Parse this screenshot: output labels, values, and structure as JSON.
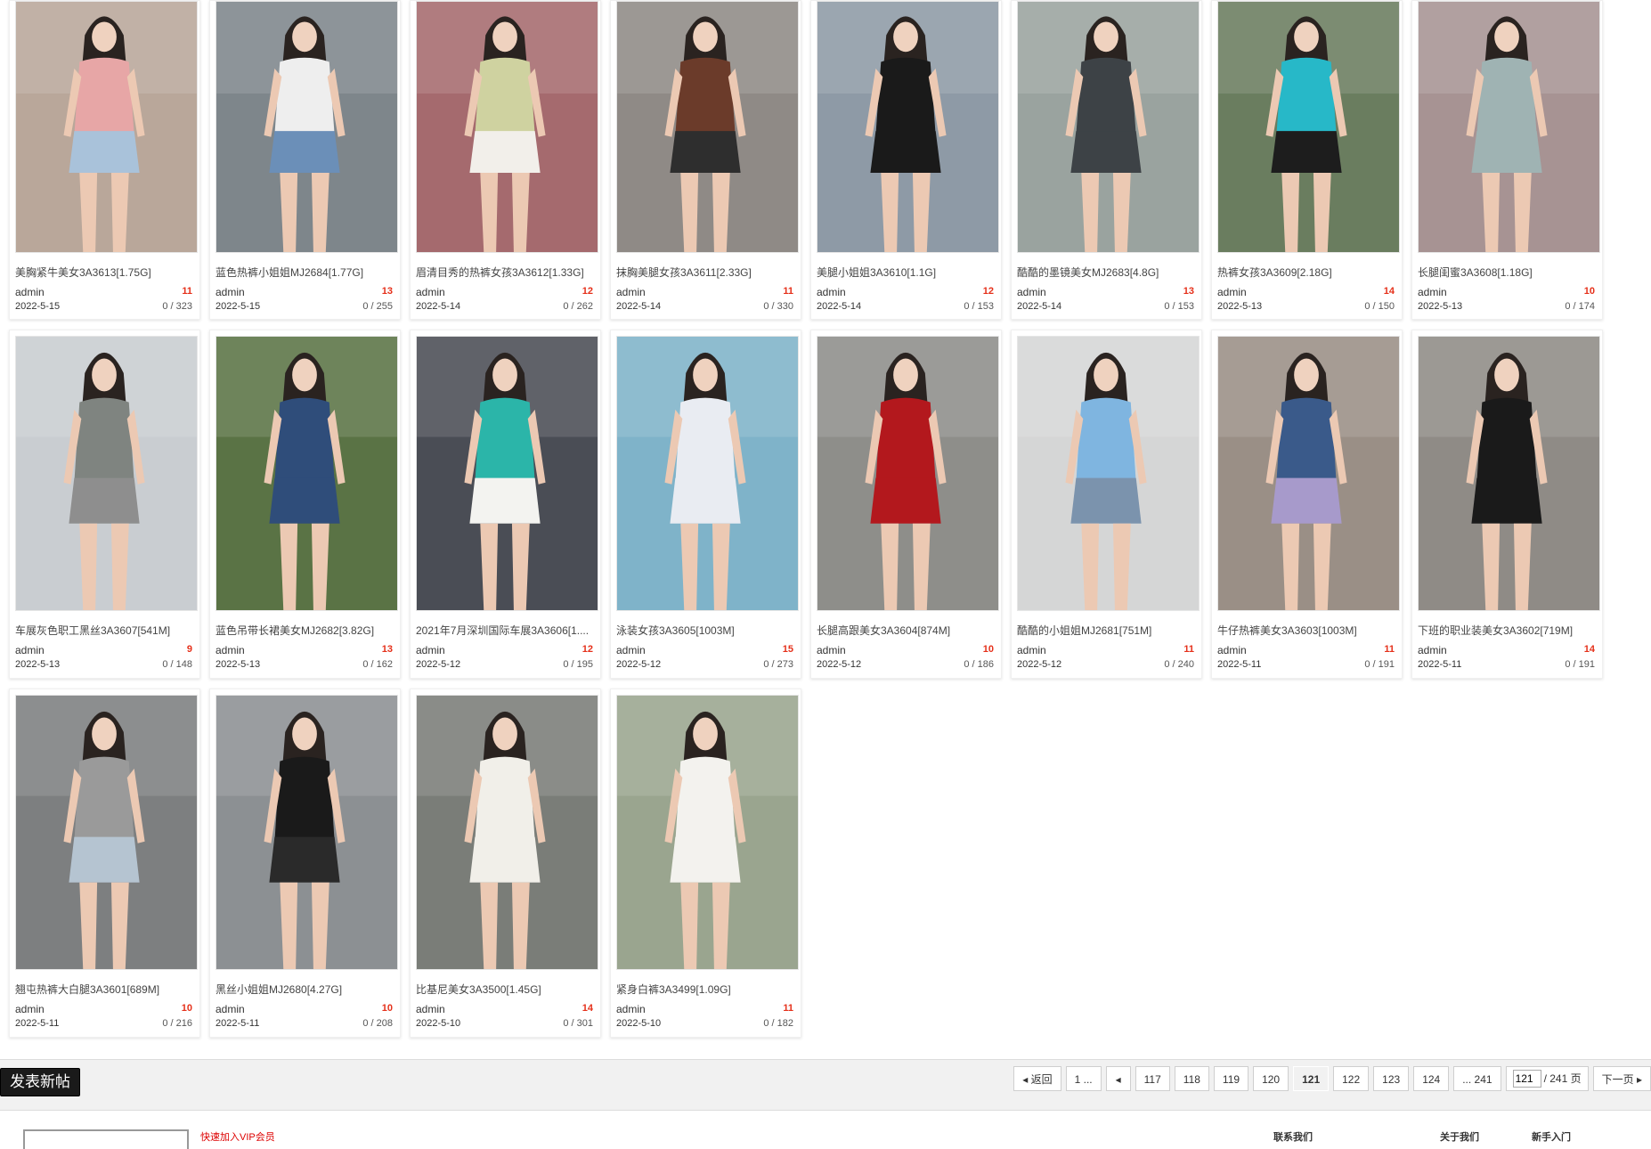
{
  "posts": [
    {
      "title": "美胸紧牛美女3A3613[1.75G]",
      "author": "admin",
      "date": "2022-5-15",
      "count": "11",
      "replies": "0 / 323",
      "bg": "#b9a79a",
      "fig": "#e7a6a6",
      "fig2": "#a9c2da"
    },
    {
      "title": "蓝色热裤小姐姐MJ2684[1.77G]",
      "author": "admin",
      "date": "2022-5-15",
      "count": "13",
      "replies": "0 / 255",
      "bg": "#7e868b",
      "fig": "#eeeeee",
      "fig2": "#6b8fb8"
    },
    {
      "title": "眉清目秀的热裤女孩3A3612[1.33G]",
      "author": "admin",
      "date": "2022-5-14",
      "count": "12",
      "replies": "0 / 262",
      "bg": "#a56a6e",
      "fig": "#cfd2a0",
      "fig2": "#f2efea"
    },
    {
      "title": "抹胸美腿女孩3A3611[2.33G]",
      "author": "admin",
      "date": "2022-5-14",
      "count": "11",
      "replies": "0 / 330",
      "bg": "#8f8a86",
      "fig": "#6b3b2a",
      "fig2": "#2e2e2e"
    },
    {
      "title": "美腿小姐姐3A3610[1.1G]",
      "author": "admin",
      "date": "2022-5-14",
      "count": "12",
      "replies": "0 / 153",
      "bg": "#8e9aa6",
      "fig": "#1a1a1a",
      "fig2": "#1a1a1a"
    },
    {
      "title": "酷酷的墨镜美女MJ2683[4.8G]",
      "author": "admin",
      "date": "2022-5-14",
      "count": "13",
      "replies": "0 / 153",
      "bg": "#9aa39f",
      "fig": "#3d4246",
      "fig2": "#3d4246"
    },
    {
      "title": "热裤女孩3A3609[2.18G]",
      "author": "admin",
      "date": "2022-5-13",
      "count": "14",
      "replies": "0 / 150",
      "bg": "#6a7d5f",
      "fig": "#27b8c8",
      "fig2": "#1d1d1d"
    },
    {
      "title": "长腿闺蜜3A3608[1.18G]",
      "author": "admin",
      "date": "2022-5-13",
      "count": "10",
      "replies": "0 / 174",
      "bg": "#a79393",
      "fig": "#9fb3b3",
      "fig2": "#9fb3b3"
    },
    {
      "title": "车展灰色职工黑丝3A3607[541M]",
      "author": "admin",
      "date": "2022-5-13",
      "count": "9",
      "replies": "0 / 148",
      "bg": "#c9cdd1",
      "fig": "#7f8480",
      "fig2": "#8e8e8e"
    },
    {
      "title": "蓝色吊带长裙美女MJ2682[3.82G]",
      "author": "admin",
      "date": "2022-5-13",
      "count": "13",
      "replies": "0 / 162",
      "bg": "#5a7345",
      "fig": "#2f4d7a",
      "fig2": "#2f4d7a"
    },
    {
      "title": "2021年7月深圳国际车展3A3606[1....",
      "author": "admin",
      "date": "2022-5-12",
      "count": "12",
      "replies": "0 / 195",
      "bg": "#4a4d55",
      "fig": "#2bb5a9",
      "fig2": "#f3f3f0"
    },
    {
      "title": "泳装女孩3A3605[1003M]",
      "author": "admin",
      "date": "2022-5-12",
      "count": "15",
      "replies": "0 / 273",
      "bg": "#7fb3c9",
      "fig": "#e9ecf2",
      "fig2": "#e9ecf2"
    },
    {
      "title": "长腿高跟美女3A3604[874M]",
      "author": "admin",
      "date": "2022-5-12",
      "count": "10",
      "replies": "0 / 186",
      "bg": "#8e8e8a",
      "fig": "#b3181d",
      "fig2": "#b3181d"
    },
    {
      "title": "酷酷的小姐姐MJ2681[751M]",
      "author": "admin",
      "date": "2022-5-12",
      "count": "11",
      "replies": "0 / 240",
      "bg": "#d5d6d6",
      "fig": "#7fb5e0",
      "fig2": "#7b93ad"
    },
    {
      "title": "牛仔热裤美女3A3603[1003M]",
      "author": "admin",
      "date": "2022-5-11",
      "count": "11",
      "replies": "0 / 191",
      "bg": "#9a8f86",
      "fig": "#3a5a8a",
      "fig2": "#a79acb"
    },
    {
      "title": "下班的职业装美女3A3602[719M]",
      "author": "admin",
      "date": "2022-5-11",
      "count": "14",
      "replies": "0 / 191",
      "bg": "#8f8b86",
      "fig": "#1a1a1a",
      "fig2": "#1a1a1a"
    },
    {
      "title": "翘屯热裤大白腿3A3601[689M]",
      "author": "admin",
      "date": "2022-5-11",
      "count": "10",
      "replies": "0 / 216",
      "bg": "#7d7f80",
      "fig": "#9a9a9a",
      "fig2": "#b5c4d1"
    },
    {
      "title": "黑丝小姐姐MJ2680[4.27G]",
      "author": "admin",
      "date": "2022-5-11",
      "count": "10",
      "replies": "0 / 208",
      "bg": "#8c9093",
      "fig": "#1a1a1a",
      "fig2": "#2a2a2a"
    },
    {
      "title": "比基尼美女3A3500[1.45G]",
      "author": "admin",
      "date": "2022-5-10",
      "count": "14",
      "replies": "0 / 301",
      "bg": "#7a7d78",
      "fig": "#f1efe9",
      "fig2": "#f1efe9"
    },
    {
      "title": "紧身白裤3A3499[1.09G]",
      "author": "admin",
      "date": "2022-5-10",
      "count": "11",
      "replies": "0 / 182",
      "bg": "#9aa58f",
      "fig": "#f3f2ee",
      "fig2": "#f3f2ee"
    }
  ],
  "toolbar": {
    "new_post_label": "发表新帖"
  },
  "pager": {
    "back_label": "返回",
    "first_label": "1 ...",
    "pages": [
      "117",
      "118",
      "119",
      "120",
      "121",
      "122",
      "123",
      "124"
    ],
    "current": "121",
    "last_label": "... 241",
    "jump_value": "121",
    "total_label": "/ 241 页",
    "next_label": "下一页"
  },
  "bottom": {
    "notice": "快速加入VIP会员",
    "link1": "联系我们",
    "link2": "关于我们",
    "link3": "新手入门"
  }
}
